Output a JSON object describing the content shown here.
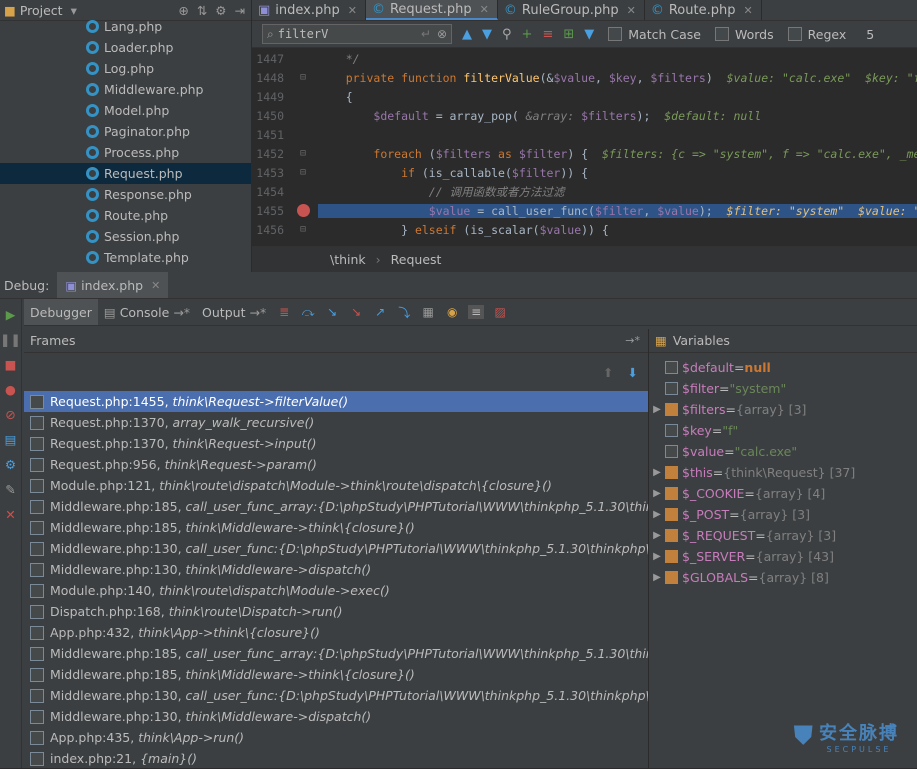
{
  "project": {
    "title": "Project",
    "items": [
      "Lang.php",
      "Loader.php",
      "Log.php",
      "Middleware.php",
      "Model.php",
      "Paginator.php",
      "Process.php",
      "Request.php",
      "Response.php",
      "Route.php",
      "Session.php",
      "Template.php"
    ],
    "selected": "Request.php"
  },
  "editor": {
    "tabs": [
      "index.php",
      "Request.php",
      "RuleGroup.php",
      "Route.php"
    ],
    "active_tab": "Request.php",
    "search": {
      "value": "filterV",
      "match_case": "Match Case",
      "words": "Words",
      "regex": "Regex",
      "count": "5"
    },
    "lines": [
      {
        "n": "1447",
        "html": "    <span class='cm'>*/</span>"
      },
      {
        "n": "1448",
        "html": "    <span class='kw'>private function</span> <span class='fn'>filterValue</span>(&amp;<span class='vr'>$value</span>, <span class='vr'>$key</span>, <span class='vr'>$filters</span>)  <span class='ann'>$value: \"calc.exe\"  $key: \"f\"  $filte</span>"
      },
      {
        "n": "1449",
        "html": "    {"
      },
      {
        "n": "1450",
        "html": "        <span class='vr'>$default</span> = array_pop( <span class='cm'>&amp;array:</span> <span class='vr'>$filters</span>);  <span class='ann'>$default: null</span>"
      },
      {
        "n": "1451",
        "html": ""
      },
      {
        "n": "1452",
        "html": "        <span class='kw'>foreach</span> (<span class='vr'>$filters</span> <span class='kw'>as</span> <span class='vr'>$filter</span>) {  <span class='ann'>$filters: {c =&gt; \"system\", f =&gt; \"calc.exe\", _method =&gt; \"</span>"
      },
      {
        "n": "1453",
        "html": "            <span class='kw'>if</span> (is_callable(<span class='vr'>$filter</span>)) {"
      },
      {
        "n": "1454",
        "html": "                <span class='cm'>// 调用函数或者方法过滤</span>"
      },
      {
        "n": "1455",
        "html": "                <span class='vr'>$value</span> = call_user_func(<span class='vr'>$filter</span>, <span class='vr'>$value</span>);  <span class='ann' style='color:#e5c07b'>$filter: \"system\"  $value: \"calc.exe\"</span>"
      },
      {
        "n": "1456",
        "html": "            } <span class='kw'>elseif</span> (is_scalar(<span class='vr'>$value</span>)) {"
      }
    ],
    "breadcrumb": [
      "\\think",
      "Request"
    ]
  },
  "debug": {
    "label": "Debug:",
    "tab": "index.php",
    "tools": {
      "debugger": "Debugger",
      "console": "Console",
      "output": "Output"
    },
    "frames_title": "Frames",
    "variables_title": "Variables",
    "frames": [
      {
        "loc": "Request.php:1455,",
        "meth": "think\\Request->filterValue()"
      },
      {
        "loc": "Request.php:1370,",
        "meth": "array_walk_recursive()"
      },
      {
        "loc": "Request.php:1370,",
        "meth": "think\\Request->input()"
      },
      {
        "loc": "Request.php:956,",
        "meth": "think\\Request->param()"
      },
      {
        "loc": "Module.php:121,",
        "meth": "think\\route\\dispatch\\Module->think\\route\\dispatch\\{closure}()"
      },
      {
        "loc": "Middleware.php:185,",
        "meth": "call_user_func_array:{D:\\phpStudy\\PHPTutorial\\WWW\\thinkphp_5.1.30\\thinkphp\\library"
      },
      {
        "loc": "Middleware.php:185,",
        "meth": "think\\Middleware->think\\{closure}()"
      },
      {
        "loc": "Middleware.php:130,",
        "meth": "call_user_func:{D:\\phpStudy\\PHPTutorial\\WWW\\thinkphp_5.1.30\\thinkphp\\library\\"
      },
      {
        "loc": "Middleware.php:130,",
        "meth": "think\\Middleware->dispatch()"
      },
      {
        "loc": "Module.php:140,",
        "meth": "think\\route\\dispatch\\Module->exec()"
      },
      {
        "loc": "Dispatch.php:168,",
        "meth": "think\\route\\Dispatch->run()"
      },
      {
        "loc": "App.php:432,",
        "meth": "think\\App->think\\{closure}()"
      },
      {
        "loc": "Middleware.php:185,",
        "meth": "call_user_func_array:{D:\\phpStudy\\PHPTutorial\\WWW\\thinkphp_5.1.30\\thinkphp\\library"
      },
      {
        "loc": "Middleware.php:185,",
        "meth": "think\\Middleware->think\\{closure}()"
      },
      {
        "loc": "Middleware.php:130,",
        "meth": "call_user_func:{D:\\phpStudy\\PHPTutorial\\WWW\\thinkphp_5.1.30\\thinkphp\\library\\"
      },
      {
        "loc": "Middleware.php:130,",
        "meth": "think\\Middleware->dispatch()"
      },
      {
        "loc": "App.php:435,",
        "meth": "think\\App->run()"
      },
      {
        "loc": "index.php:21,",
        "meth": "{main}()"
      }
    ],
    "variables": [
      {
        "name": "$default",
        "val": "null",
        "kind": "null",
        "exp": false
      },
      {
        "name": "$filter",
        "val": "\"system\"",
        "kind": "str",
        "exp": false
      },
      {
        "name": "$filters",
        "val": "{array} [3]",
        "kind": "type",
        "exp": true
      },
      {
        "name": "$key",
        "val": "\"f\"",
        "kind": "str",
        "exp": false
      },
      {
        "name": "$value",
        "val": "\"calc.exe\"",
        "kind": "str",
        "exp": false
      },
      {
        "name": "$this",
        "val": "{think\\Request} [37]",
        "kind": "type",
        "exp": true
      },
      {
        "name": "$_COOKIE",
        "val": "{array} [4]",
        "kind": "type",
        "exp": true
      },
      {
        "name": "$_POST",
        "val": "{array} [3]",
        "kind": "type",
        "exp": true
      },
      {
        "name": "$_REQUEST",
        "val": "{array} [3]",
        "kind": "type",
        "exp": true
      },
      {
        "name": "$_SERVER",
        "val": "{array} [43]",
        "kind": "type",
        "exp": true
      },
      {
        "name": "$GLOBALS",
        "val": "{array} [8]",
        "kind": "type",
        "exp": true
      }
    ]
  },
  "watermark": {
    "cn": "安全脉搏",
    "en": "SECPULSE"
  }
}
